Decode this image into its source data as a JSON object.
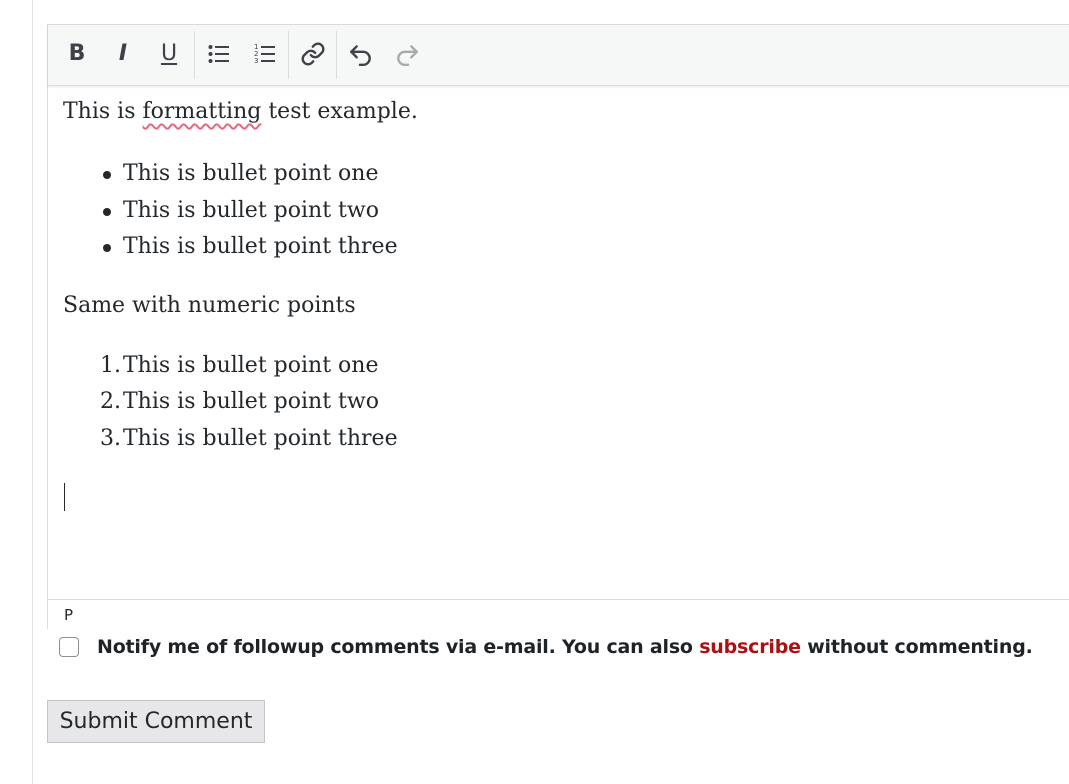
{
  "toolbar": {
    "bold_label": "B",
    "italic_label": "I",
    "underline_label": "U",
    "icons": [
      "bold-icon",
      "italic-icon",
      "underline-icon",
      "bullet-list-icon",
      "numbered-list-icon",
      "link-icon",
      "undo-icon",
      "redo-icon"
    ],
    "redo_disabled": true
  },
  "editor": {
    "paragraph1": {
      "before": "This is ",
      "misspelled": "formatting",
      "after": " test example."
    },
    "bullets": [
      "This is bullet point one",
      "This is bullet point two",
      "This is bullet point three"
    ],
    "paragraph2": "Same with numeric points",
    "numbered": [
      {
        "num": "1.",
        "text": "This is bullet point one"
      },
      {
        "num": "2.",
        "text": "This is bullet point two"
      },
      {
        "num": "3.",
        "text": "This is bullet point three"
      }
    ],
    "status_path": "P"
  },
  "notify": {
    "before": "Notify me of followup comments via e-mail. You can also ",
    "link": "subscribe",
    "after": " without commenting."
  },
  "submit": {
    "label": "Submit Comment"
  },
  "colors": {
    "link": "#aa1111",
    "spellcheck_underline": "#e8677f",
    "toolbar_bg": "#f6f7f7"
  }
}
